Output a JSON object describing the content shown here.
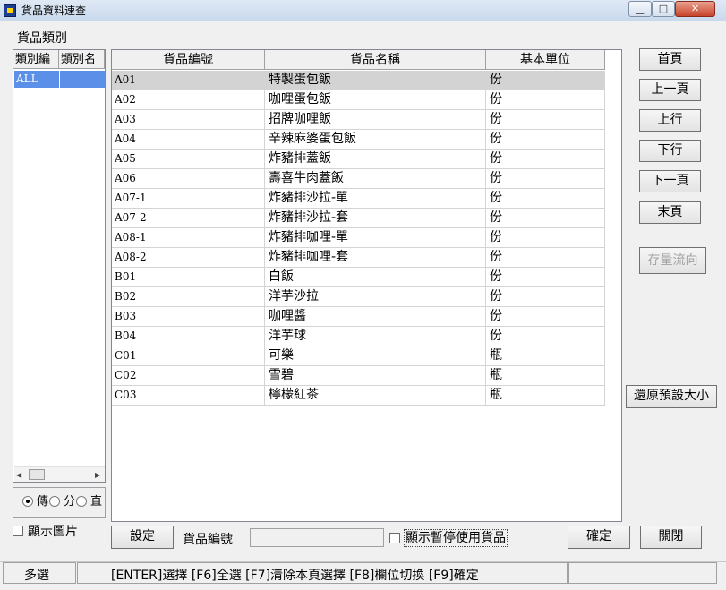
{
  "window": {
    "title": "貨品資料速查",
    "min_label": "▁",
    "max_label": "□",
    "close_label": "✕"
  },
  "category": {
    "label": "貨品類別",
    "col1": "類別編",
    "col2": "類別名",
    "selected_code": "ALL",
    "radios": [
      {
        "label": "傳",
        "checked": true
      },
      {
        "label": "分",
        "checked": false
      },
      {
        "label": "直",
        "checked": false
      }
    ]
  },
  "show_picture": {
    "label": "顯示圖片",
    "checked": false
  },
  "grid": {
    "headers": [
      "貨品編號",
      "貨品名稱",
      "基本單位"
    ],
    "rows": [
      [
        "A01",
        "特製蛋包飯",
        "份"
      ],
      [
        "A02",
        "咖哩蛋包飯",
        "份"
      ],
      [
        "A03",
        "招牌咖哩飯",
        "份"
      ],
      [
        "A04",
        "辛辣麻婆蛋包飯",
        "份"
      ],
      [
        "A05",
        "炸豬排蓋飯",
        "份"
      ],
      [
        "A06",
        "壽喜牛肉蓋飯",
        "份"
      ],
      [
        "A07-1",
        "炸豬排沙拉-單",
        "份"
      ],
      [
        "A07-2",
        "炸豬排沙拉-套",
        "份"
      ],
      [
        "A08-1",
        "炸豬排咖哩-單",
        "份"
      ],
      [
        "A08-2",
        "炸豬排咖哩-套",
        "份"
      ],
      [
        "B01",
        "白飯",
        "份"
      ],
      [
        "B02",
        "洋芋沙拉",
        "份"
      ],
      [
        "B03",
        "咖哩醬",
        "份"
      ],
      [
        "B04",
        "洋芋球",
        "份"
      ],
      [
        "C01",
        "可樂",
        "瓶"
      ],
      [
        "C02",
        "雪碧",
        "瓶"
      ],
      [
        "C03",
        "檸檬紅茶",
        "瓶"
      ]
    ]
  },
  "nav": {
    "first": "首頁",
    "prev_page": "上一頁",
    "prev_row": "上行",
    "next_row": "下行",
    "next_page": "下一頁",
    "last": "末頁",
    "stock_flow": "存量流向",
    "restore_size": "還原預設大小"
  },
  "bottom": {
    "settings": "設定",
    "code_label": "貨品編號",
    "code_value": "",
    "show_paused": "顯示暫停使用貨品",
    "show_paused_checked": false,
    "ok": "確定",
    "close": "關閉"
  },
  "status": {
    "mode": "多選",
    "help": "[ENTER]選擇 [F6]全選 [F7]清除本頁選擇 [F8]欄位切換 [F9]確定"
  },
  "colors": {
    "selection": "#5b8fe8",
    "row_highlight": "#d3d3d3"
  }
}
